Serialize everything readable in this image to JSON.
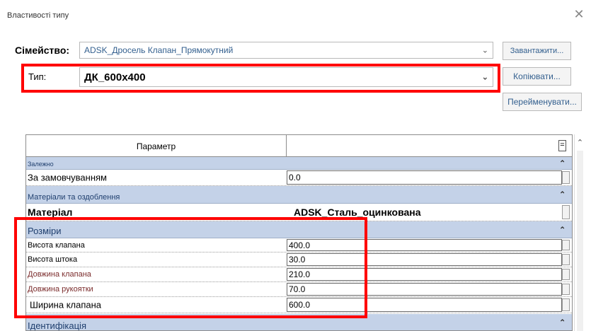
{
  "dialog": {
    "title": "Властивості типу",
    "close_glyph": "✕"
  },
  "family": {
    "label": "Сімейство:",
    "value": "ADSK_Дросель Клапан_Прямокутний"
  },
  "type": {
    "label": "Тип:",
    "value": "ДК_600х400"
  },
  "buttons": {
    "load": "Завантажити...",
    "copy": "Копіювати...",
    "rename": "Перейменувати..."
  },
  "table": {
    "header_param": "Параметр",
    "header_eq": "=",
    "groups": [
      {
        "name": "Залежно",
        "rows": [
          {
            "name": "За замовчуванням",
            "value": "0.0"
          }
        ]
      },
      {
        "name": "Матеріали та оздоблення",
        "rows": [
          {
            "name": "Матеріал",
            "value": "ADSK_Сталь_оцинкована"
          }
        ]
      },
      {
        "name": "Розміри",
        "rows": [
          {
            "name": "Висота клапана",
            "value": "400.0"
          },
          {
            "name": "Висота штока",
            "value": "30.0"
          },
          {
            "name": "Довжина клапана",
            "value": "210.0"
          },
          {
            "name": "Довжина рукоятки",
            "value": "70.0"
          },
          {
            "name": "Ширина клапана",
            "value": "600.0"
          }
        ]
      },
      {
        "name": "Ідентифікація",
        "rows": []
      }
    ]
  },
  "colors": {
    "group_bg": "#c4d2e8",
    "highlight": "#ff0000",
    "link_text": "#34608f"
  }
}
